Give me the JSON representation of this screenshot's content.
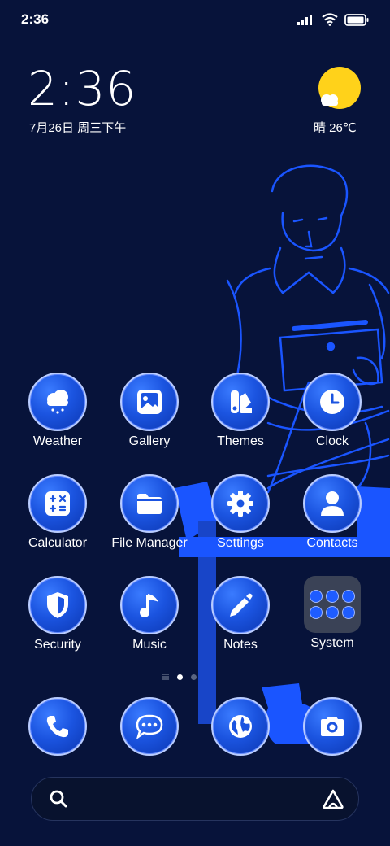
{
  "status_bar": {
    "time": "2:36",
    "icons": [
      "signal-icon",
      "wifi-icon",
      "battery-icon"
    ]
  },
  "clock_widget": {
    "time": "2:36",
    "date": "7月26日 周三下午"
  },
  "weather_widget": {
    "text": "晴 26℃",
    "icon": "sun-cloud-icon"
  },
  "apps": [
    {
      "label": "Weather",
      "icon": "cloud-snow-icon"
    },
    {
      "label": "Gallery",
      "icon": "image-icon"
    },
    {
      "label": "Themes",
      "icon": "palette-icon"
    },
    {
      "label": "Clock",
      "icon": "clock-icon"
    },
    {
      "label": "Calculator",
      "icon": "calculator-icon"
    },
    {
      "label": "File Manager",
      "icon": "folder-icon"
    },
    {
      "label": "Settings",
      "icon": "gear-icon"
    },
    {
      "label": "Contacts",
      "icon": "person-icon"
    },
    {
      "label": "Security",
      "icon": "shield-icon"
    },
    {
      "label": "Music",
      "icon": "music-note-icon"
    },
    {
      "label": "Notes",
      "icon": "pencil-icon"
    },
    {
      "label": "System",
      "icon": "folder-grid-icon"
    }
  ],
  "dock": [
    {
      "icon": "phone-icon"
    },
    {
      "icon": "message-icon"
    },
    {
      "icon": "globe-icon"
    },
    {
      "icon": "camera-icon"
    }
  ],
  "page_indicator": {
    "pages": 2,
    "current": 1
  },
  "colors": {
    "background": "#07133a",
    "accent": "#1b54e0",
    "sun": "#ffd21a"
  }
}
